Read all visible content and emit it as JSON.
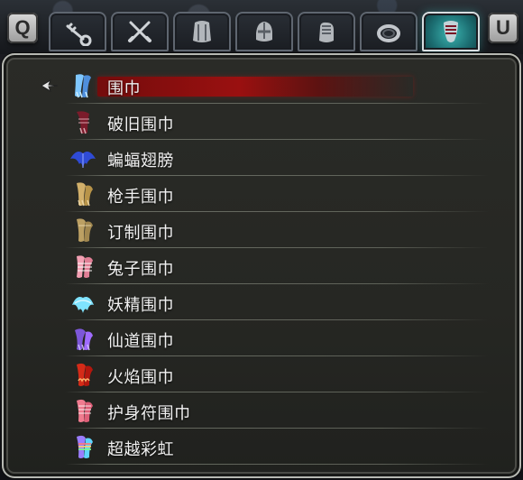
{
  "top_bar": {
    "left_key": "Q",
    "right_key": "U",
    "tabs": [
      {
        "icon": "key-icon",
        "active": false
      },
      {
        "icon": "crossed-swords-icon",
        "active": false
      },
      {
        "icon": "body-armor-icon",
        "active": false
      },
      {
        "icon": "helmet-icon",
        "active": false
      },
      {
        "icon": "gauntlet-icon",
        "active": false
      },
      {
        "icon": "ring-icon",
        "active": false
      },
      {
        "icon": "scarf-icon",
        "active": true
      }
    ]
  },
  "list": {
    "selected_index": 0,
    "items": [
      {
        "label": "围巾",
        "icon": "scarf-icon",
        "icon_color": "#7fc7ff"
      },
      {
        "label": "破旧围巾",
        "icon": "scarf-icon",
        "icon_color": "#7b1b2b"
      },
      {
        "label": "蝙蝠翅膀",
        "icon": "bat-wing-icon",
        "icon_color": "#2f4bd6"
      },
      {
        "label": "枪手围巾",
        "icon": "scarf-icon",
        "icon_color": "#d2b06a"
      },
      {
        "label": "订制围巾",
        "icon": "scarf-icon",
        "icon_color": "#bca063"
      },
      {
        "label": "兔子围巾",
        "icon": "scarf-icon",
        "icon_color": "#f3a0b3"
      },
      {
        "label": "妖精围巾",
        "icon": "fairy-scarf-icon",
        "icon_color": "#7fe3ff"
      },
      {
        "label": "仙道围巾",
        "icon": "scarf-icon",
        "icon_color": "#7d57d9"
      },
      {
        "label": "火焰围巾",
        "icon": "flame-scarf-icon",
        "icon_color": "#d52b18"
      },
      {
        "label": "护身符围巾",
        "icon": "amulet-scarf-icon",
        "icon_color": "#f07b8f"
      },
      {
        "label": "超越彩虹",
        "icon": "rainbow-scarf-icon",
        "icon_color": "#9b7dff"
      }
    ]
  }
}
